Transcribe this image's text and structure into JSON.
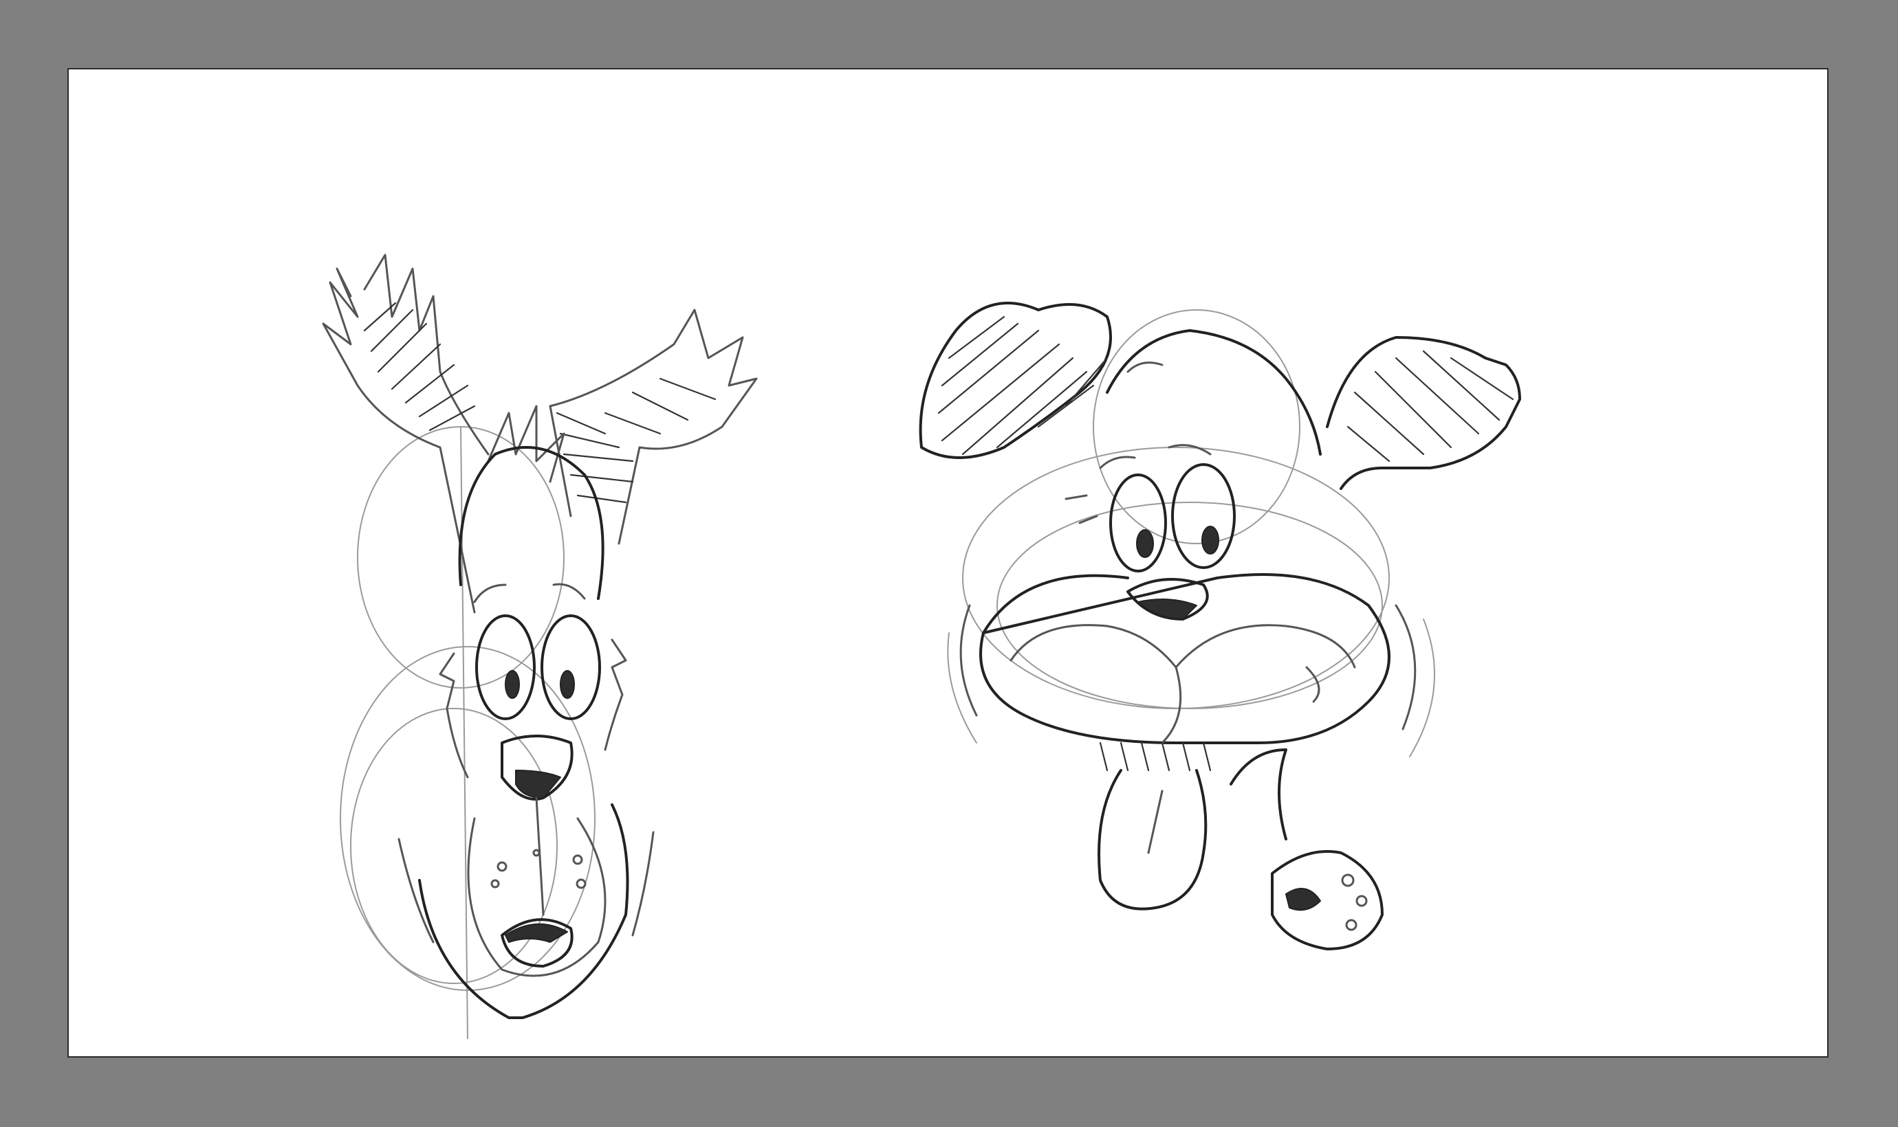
{
  "app": {
    "background_color": "#808080",
    "canvas_color": "#ffffff",
    "stroke_color": "#3a3a3a"
  },
  "canvas": {
    "drawings": [
      {
        "id": "dog-front-view",
        "icon": "dog-sketch-front"
      },
      {
        "id": "dog-tongue-out-view",
        "icon": "dog-sketch-tongue-out"
      }
    ]
  }
}
